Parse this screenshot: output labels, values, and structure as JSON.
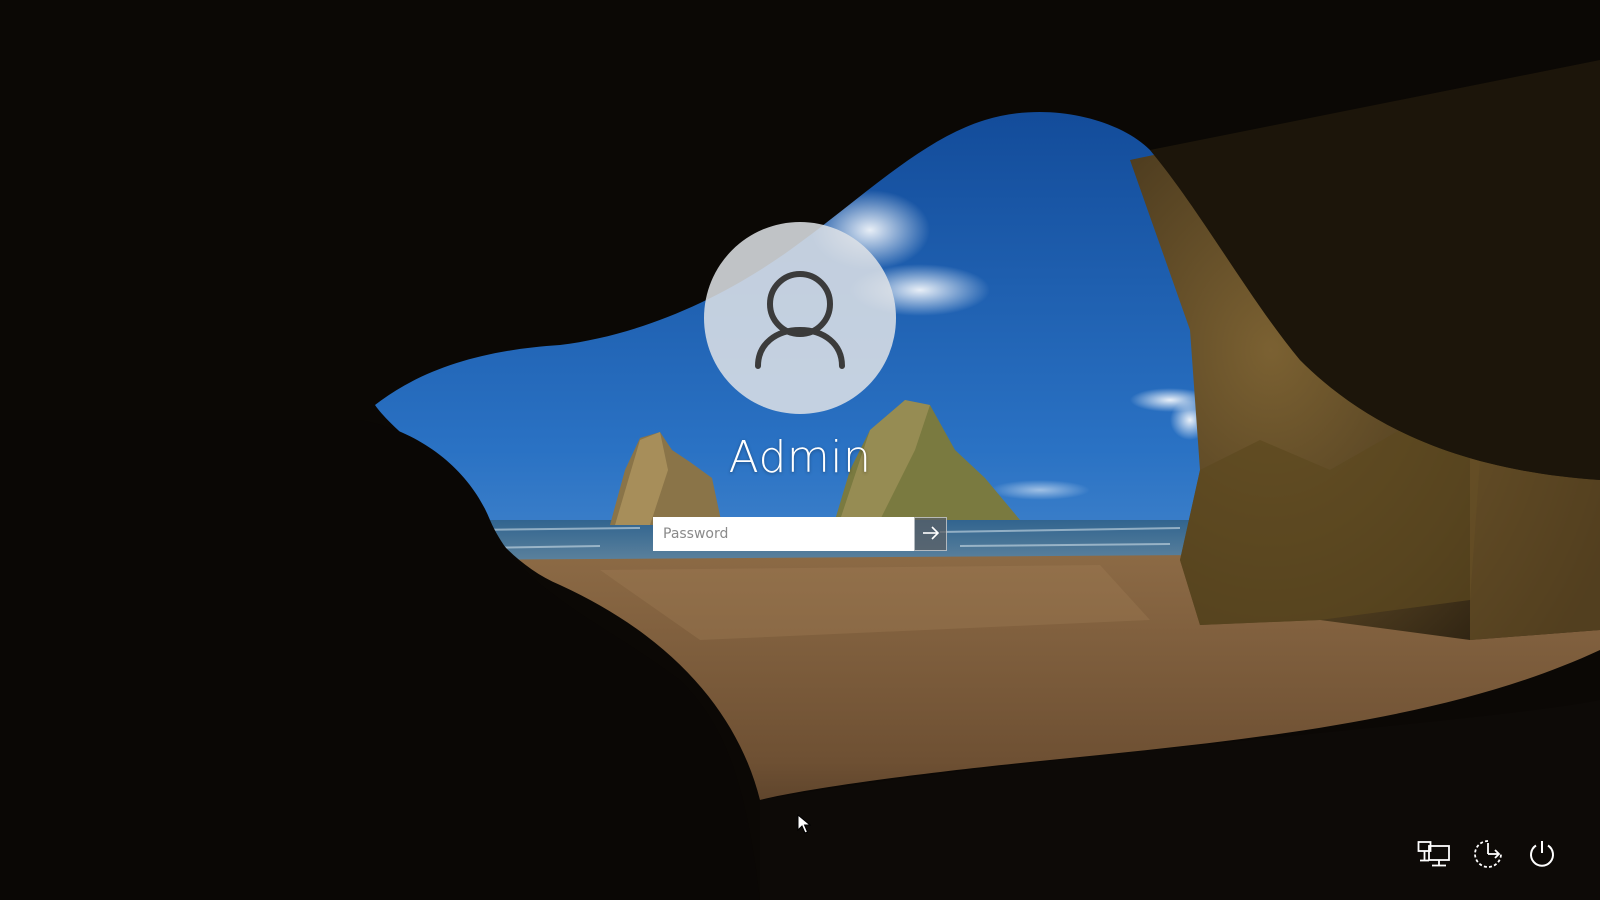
{
  "user": {
    "name": "Admin",
    "avatar_icon": "user-silhouette-icon"
  },
  "password": {
    "placeholder": "Password",
    "value": "",
    "submit_icon": "arrow-right-icon"
  },
  "tray": {
    "network_icon": "network-icon",
    "accessibility_icon": "ease-of-access-icon",
    "power_icon": "power-icon"
  },
  "colors": {
    "text": "#ffffff",
    "avatar_bg": "#dee2e6",
    "input_bg": "#ffffff"
  }
}
